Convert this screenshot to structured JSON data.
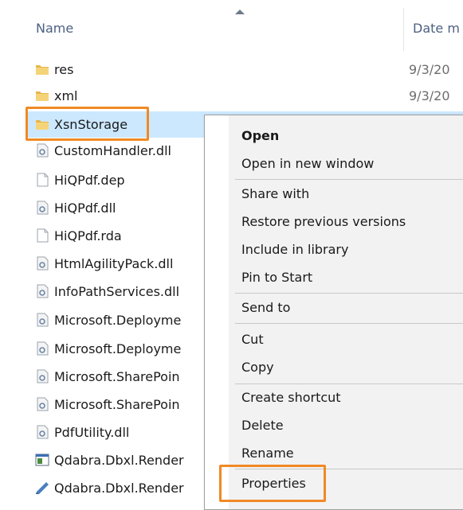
{
  "header": {
    "name_label": "Name",
    "date_label": "Date m"
  },
  "rows": [
    {
      "name": "res",
      "date": "9/3/20",
      "icon": "folder-icon"
    },
    {
      "name": "xml",
      "date": "9/3/20",
      "icon": "folder-icon"
    },
    {
      "name": "XsnStorage",
      "date": "",
      "icon": "folder-icon",
      "selected": true
    },
    {
      "name": "CustomHandler.dll",
      "date": "",
      "icon": "dll-icon"
    },
    {
      "name": "HiQPdf.dep",
      "date": "",
      "icon": "file-icon"
    },
    {
      "name": "HiQPdf.dll",
      "date": "",
      "icon": "dll-icon"
    },
    {
      "name": "HiQPdf.rda",
      "date": "",
      "icon": "file-icon"
    },
    {
      "name": "HtmlAgilityPack.dll",
      "date": "",
      "icon": "dll-icon"
    },
    {
      "name": "InfoPathServices.dll",
      "date": "",
      "icon": "dll-icon"
    },
    {
      "name": "Microsoft.Deployme",
      "date": "",
      "icon": "dll-icon"
    },
    {
      "name": "Microsoft.Deployme",
      "date": "",
      "icon": "dll-icon"
    },
    {
      "name": "Microsoft.SharePoin",
      "date": "",
      "icon": "dll-icon"
    },
    {
      "name": "Microsoft.SharePoin",
      "date": "",
      "icon": "dll-icon"
    },
    {
      "name": "PdfUtility.dll",
      "date": "",
      "icon": "dll-icon"
    },
    {
      "name": "Qdabra.Dbxl.Render",
      "date": "",
      "icon": "exe-icon"
    },
    {
      "name": "Qdabra.Dbxl.Render",
      "date": "",
      "icon": "config-icon"
    }
  ],
  "context_menu": {
    "items": [
      {
        "label": "Open",
        "bold": true
      },
      {
        "label": "Open in new window"
      },
      {
        "label": "Share with"
      },
      {
        "label": "Restore previous versions"
      },
      {
        "label": "Include in library"
      },
      {
        "label": "Pin to Start"
      },
      {
        "label": "Send to"
      },
      {
        "label": "Cut"
      },
      {
        "label": "Copy"
      },
      {
        "label": "Create shortcut"
      },
      {
        "label": "Delete"
      },
      {
        "label": "Rename"
      },
      {
        "label": "Properties"
      }
    ]
  },
  "colors": {
    "highlight": "#f08a25",
    "selection": "#cce8ff",
    "header_text": "#4d6082"
  }
}
